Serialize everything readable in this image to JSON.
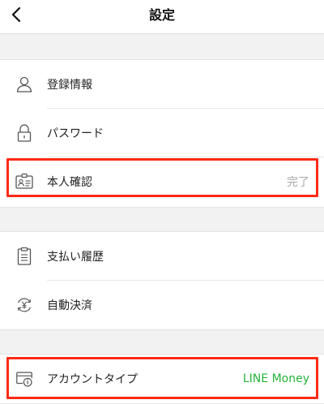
{
  "header": {
    "title": "設定",
    "back_icon": "chevron-left-icon"
  },
  "sections": [
    {
      "items": [
        {
          "label": "登録情報",
          "icon": "person-icon",
          "value": ""
        },
        {
          "label": "パスワード",
          "icon": "lock-icon",
          "value": ""
        },
        {
          "label": "本人確認",
          "icon": "id-card-icon",
          "value": "完了"
        }
      ]
    },
    {
      "items": [
        {
          "label": "支払い履歴",
          "icon": "clipboard-icon",
          "value": ""
        },
        {
          "label": "自動決済",
          "icon": "yen-cycle-icon",
          "value": ""
        }
      ]
    },
    {
      "items": [
        {
          "label": "アカウントタイプ",
          "icon": "account-type-icon",
          "value": "LINE Money"
        }
      ]
    }
  ],
  "colors": {
    "highlight": "#ff2a14",
    "value_gray": "#a8a8a8",
    "value_green": "#25b33a",
    "background": "#f2f2f2"
  }
}
